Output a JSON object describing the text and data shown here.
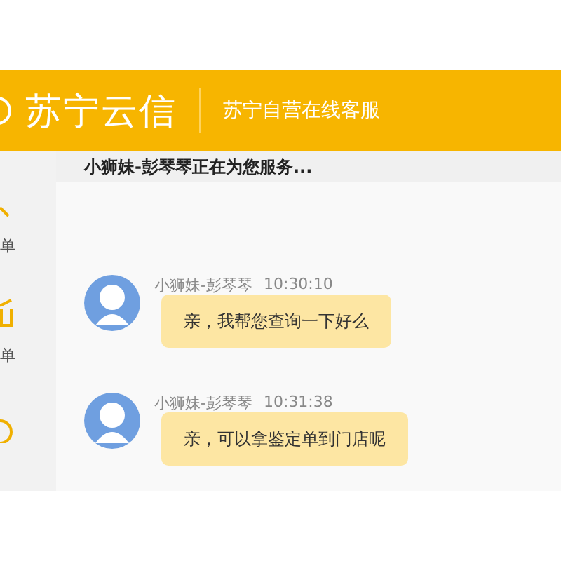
{
  "header": {
    "logo_text": "苏宁云信",
    "subtitle": "苏宁自营在线客服"
  },
  "service_bar": {
    "text": "小狮妹-彭琴琴正在为您服务..."
  },
  "sidebar": {
    "items": [
      {
        "label": "单"
      },
      {
        "label": "单"
      }
    ]
  },
  "messages": [
    {
      "sender": "小狮妹-彭琴琴",
      "time": "10:30:10",
      "text": "亲，我帮您查询一下好么"
    },
    {
      "sender": "小狮妹-彭琴琴",
      "time": "10:31:38",
      "text": "亲，可以拿鉴定单到门店呢"
    }
  ]
}
